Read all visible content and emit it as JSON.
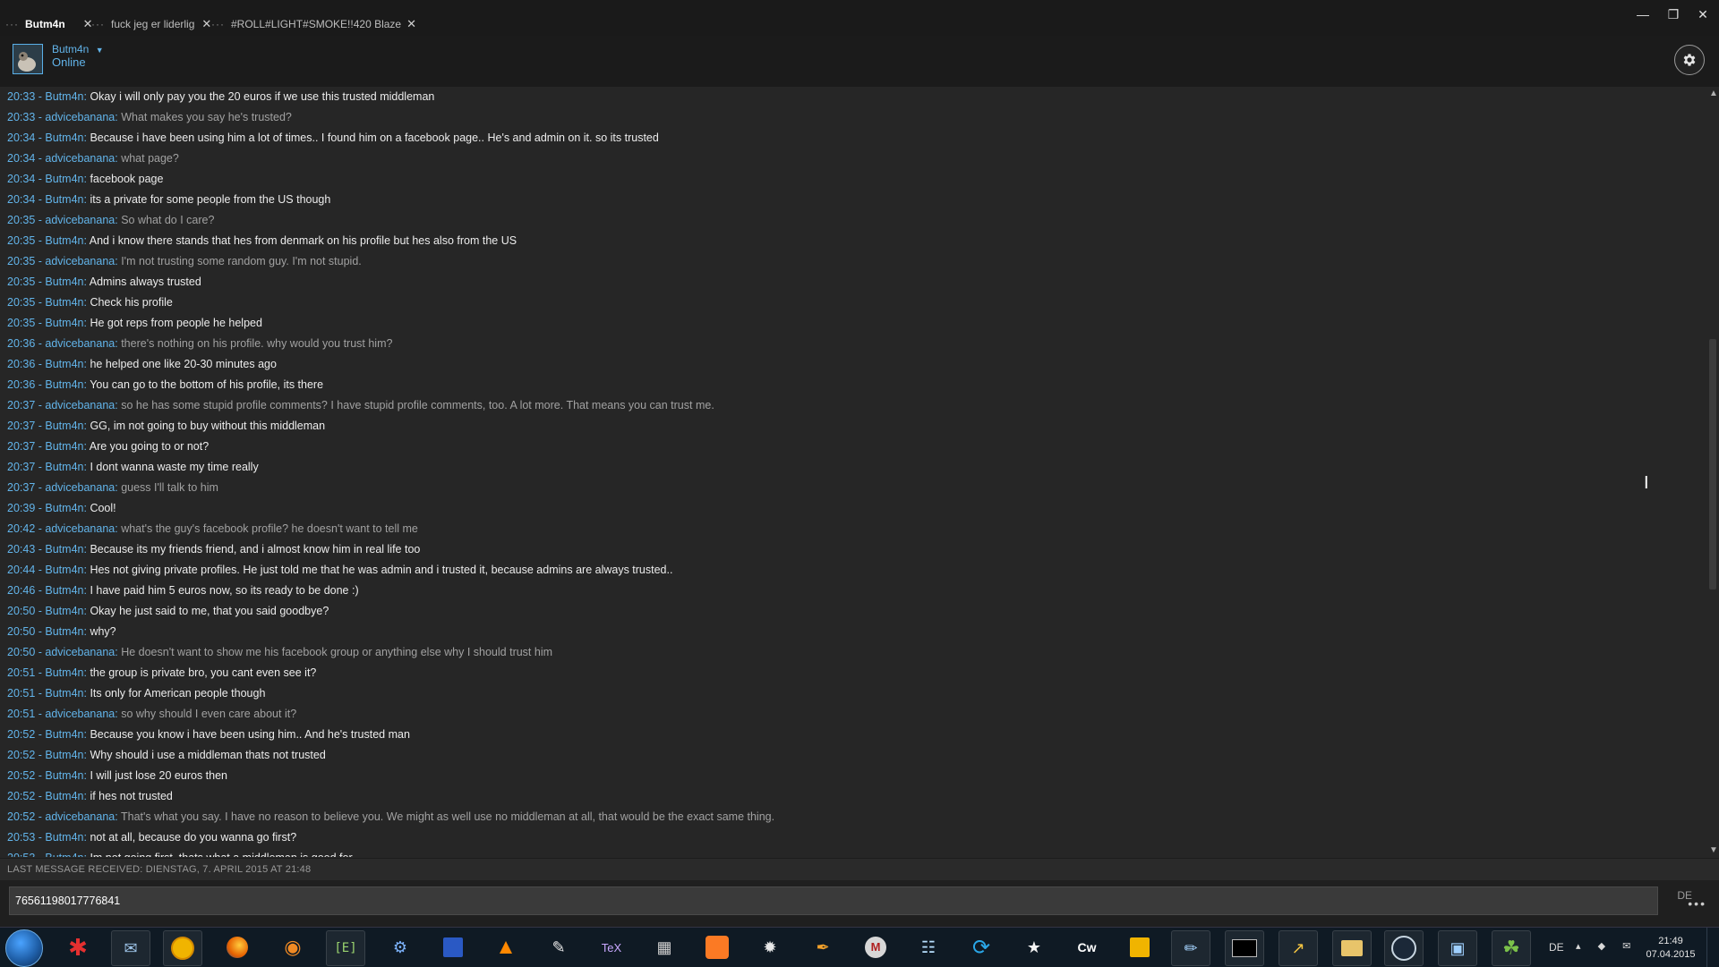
{
  "tabs": [
    {
      "label": "Butm4n",
      "active": true
    },
    {
      "label": "fuck jeg er liderlig",
      "active": false
    },
    {
      "label": "#ROLL#LIGHT#SMOKE!!420 Blaze",
      "active": false
    }
  ],
  "tab_dots": "···",
  "tab_close": "✕",
  "window_controls": {
    "minimize": "—",
    "restore": "❐",
    "close": "✕"
  },
  "header": {
    "username": "Butm4n",
    "dropdown": "⌵",
    "status": "Online"
  },
  "colors": {
    "accent": "#62b4ea",
    "me_text": "#ececec",
    "them_text": "#a1a1a1",
    "background": "#262626"
  },
  "messages": [
    {
      "time": "20:33",
      "author": "Butm4n",
      "text": "Okay i will only pay you the 20 euros if we use this trusted middleman",
      "self": true
    },
    {
      "time": "20:33",
      "author": "advicebanana",
      "text": "What makes you say he's trusted?",
      "self": false
    },
    {
      "time": "20:34",
      "author": "Butm4n",
      "text": "Because i have been using him a lot of times.. I found him on a facebook page.. He's and admin on it. so its trusted",
      "self": true
    },
    {
      "time": "20:34",
      "author": "advicebanana",
      "text": "what page?",
      "self": false
    },
    {
      "time": "20:34",
      "author": "Butm4n",
      "text": "facebook page",
      "self": true
    },
    {
      "time": "20:34",
      "author": "Butm4n",
      "text": "its a private for some people from the US though",
      "self": true
    },
    {
      "time": "20:35",
      "author": "advicebanana",
      "text": "So what do I care?",
      "self": false
    },
    {
      "time": "20:35",
      "author": "Butm4n",
      "text": "And i know there stands that hes from denmark on his profile but hes also from the US",
      "self": true
    },
    {
      "time": "20:35",
      "author": "advicebanana",
      "text": "I'm not trusting some random guy. I'm not stupid.",
      "self": false
    },
    {
      "time": "20:35",
      "author": "Butm4n",
      "text": "Admins always trusted",
      "self": true
    },
    {
      "time": "20:35",
      "author": "Butm4n",
      "text": "Check his profile",
      "self": true
    },
    {
      "time": "20:35",
      "author": "Butm4n",
      "text": "He got reps from people he helped",
      "self": true
    },
    {
      "time": "20:36",
      "author": "advicebanana",
      "text": "there's nothing on his profile. why would you trust him?",
      "self": false
    },
    {
      "time": "20:36",
      "author": "Butm4n",
      "text": "he helped one like 20-30 minutes ago",
      "self": true
    },
    {
      "time": "20:36",
      "author": "Butm4n",
      "text": "You can go to the bottom of his profile, its there",
      "self": true
    },
    {
      "time": "20:37",
      "author": "advicebanana",
      "text": "so he has some stupid profile comments? I have stupid profile comments, too. A lot more. That means you can trust me.",
      "self": false
    },
    {
      "time": "20:37",
      "author": "Butm4n",
      "text": "GG, im not going to buy without this middleman",
      "self": true
    },
    {
      "time": "20:37",
      "author": "Butm4n",
      "text": "Are you going to or not?",
      "self": true
    },
    {
      "time": "20:37",
      "author": "Butm4n",
      "text": "I dont wanna waste my time really",
      "self": true
    },
    {
      "time": "20:37",
      "author": "advicebanana",
      "text": "guess I'll talk to him",
      "self": false
    },
    {
      "time": "20:39",
      "author": "Butm4n",
      "text": "Cool!",
      "self": true
    },
    {
      "time": "20:42",
      "author": "advicebanana",
      "text": "what's the guy's facebook profile? he doesn't want to tell me",
      "self": false
    },
    {
      "time": "20:43",
      "author": "Butm4n",
      "text": "Because its my friends friend, and i almost know him in real life too",
      "self": true
    },
    {
      "time": "20:44",
      "author": "Butm4n",
      "text": "Hes not giving private profiles. He just told me that he was admin and i trusted it, because admins are always trusted..",
      "self": true
    },
    {
      "time": "20:46",
      "author": "Butm4n",
      "text": "I have paid him 5 euros now, so its ready to be done :)",
      "self": true
    },
    {
      "time": "20:50",
      "author": "Butm4n",
      "text": "Okay he just said to me, that you said goodbye?",
      "self": true
    },
    {
      "time": "20:50",
      "author": "Butm4n",
      "text": "why?",
      "self": true
    },
    {
      "time": "20:50",
      "author": "advicebanana",
      "text": "He doesn't want to show me his facebook group or anything else why I should trust him",
      "self": false
    },
    {
      "time": "20:51",
      "author": "Butm4n",
      "text": "the group is private bro, you cant even see it?",
      "self": true
    },
    {
      "time": "20:51",
      "author": "Butm4n",
      "text": "Its only for American people though",
      "self": true
    },
    {
      "time": "20:51",
      "author": "advicebanana",
      "text": "so why should I even care about it?",
      "self": false
    },
    {
      "time": "20:52",
      "author": "Butm4n",
      "text": "Because you know i have been using him.. And he's trusted man",
      "self": true
    },
    {
      "time": "20:52",
      "author": "Butm4n",
      "text": "Why should i use a middleman thats not trusted",
      "self": true
    },
    {
      "time": "20:52",
      "author": "Butm4n",
      "text": "I will just lose 20 euros then",
      "self": true
    },
    {
      "time": "20:52",
      "author": "Butm4n",
      "text": "if hes not trusted",
      "self": true
    },
    {
      "time": "20:52",
      "author": "advicebanana",
      "text": "That's what you say. I have no reason to believe you. We might as well use no middleman at all, that would be the exact same thing.",
      "self": false
    },
    {
      "time": "20:53",
      "author": "Butm4n",
      "text": "not at all, because do you wanna go first?",
      "self": true
    },
    {
      "time": "20:53",
      "author": "Butm4n",
      "text": "Im not going first, thats what a middleman is good for",
      "self": true
    }
  ],
  "last_message": "LAST MESSAGE RECEIVED: DIENSTAG, 7. APRIL 2015 AT 21:48",
  "input": {
    "value": "76561198017776841",
    "lang": "DE",
    "more": "•••"
  },
  "scroll": {
    "up": "▲",
    "down": "▼"
  },
  "cursor_glyph": "I",
  "taskbar": {
    "lang": "DE",
    "tray": "▴ ◆ ✉",
    "time": "21:49",
    "date": "07.04.2015"
  }
}
